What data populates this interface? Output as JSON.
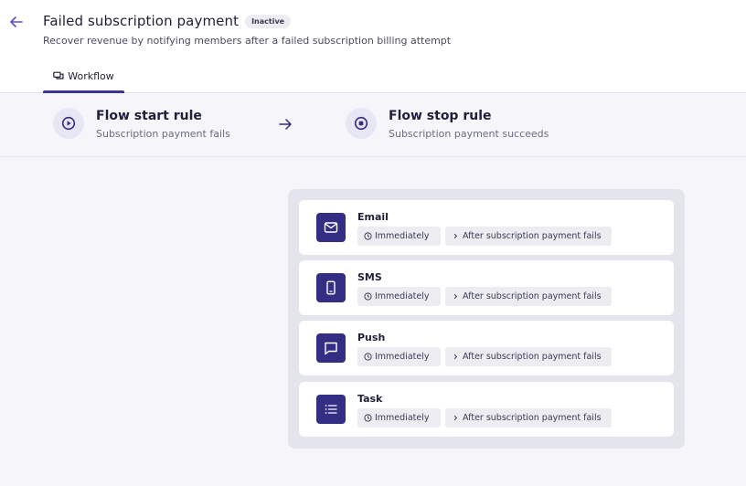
{
  "header": {
    "title": "Failed subscription payment",
    "status_badge": "Inactive",
    "subtitle": "Recover revenue by notifying members after a failed subscription billing attempt"
  },
  "tabs": [
    {
      "label": "Workflow",
      "icon": "workflow-icon",
      "active": true
    }
  ],
  "rules": {
    "start": {
      "title": "Flow start rule",
      "subtitle": "Subscription payment fails",
      "icon": "play-circle-icon"
    },
    "stop": {
      "title": "Flow stop rule",
      "subtitle": "Subscription payment succeeds",
      "icon": "stop-circle-icon"
    }
  },
  "steps": [
    {
      "name": "Email",
      "icon": "email-icon",
      "timing": "Immediately",
      "trigger": "After subscription payment fails"
    },
    {
      "name": "SMS",
      "icon": "phone-icon",
      "timing": "Immediately",
      "trigger": "After subscription payment fails"
    },
    {
      "name": "Push",
      "icon": "chat-icon",
      "timing": "Immediately",
      "trigger": "After subscription payment fails"
    },
    {
      "name": "Task",
      "icon": "list-icon",
      "timing": "Immediately",
      "trigger": "After subscription payment fails"
    }
  ],
  "colors": {
    "accent": "#332e84",
    "accent_light": "#e7e6f4",
    "back_arrow": "#5a50c8",
    "panel_bg": "#e4e4ec",
    "chip_bg": "#ececf1"
  }
}
